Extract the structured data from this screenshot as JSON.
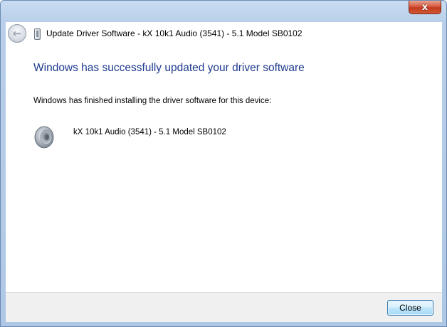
{
  "window": {
    "title": "Update Driver Software - kX 10k1 Audio (3541) - 5.1 Model SB0102",
    "close_glyph": "x"
  },
  "content": {
    "heading": "Windows has successfully updated your driver software",
    "info": "Windows has finished installing the driver software for this device:",
    "device_name": "kX 10k1 Audio (3541) - 5.1 Model SB0102",
    "device_icon": "speaker-icon"
  },
  "footer": {
    "close_label": "Close"
  },
  "colors": {
    "heading": "#1e3a8f",
    "frame": "#b9cfe9",
    "close_x": "#c23b1f"
  }
}
